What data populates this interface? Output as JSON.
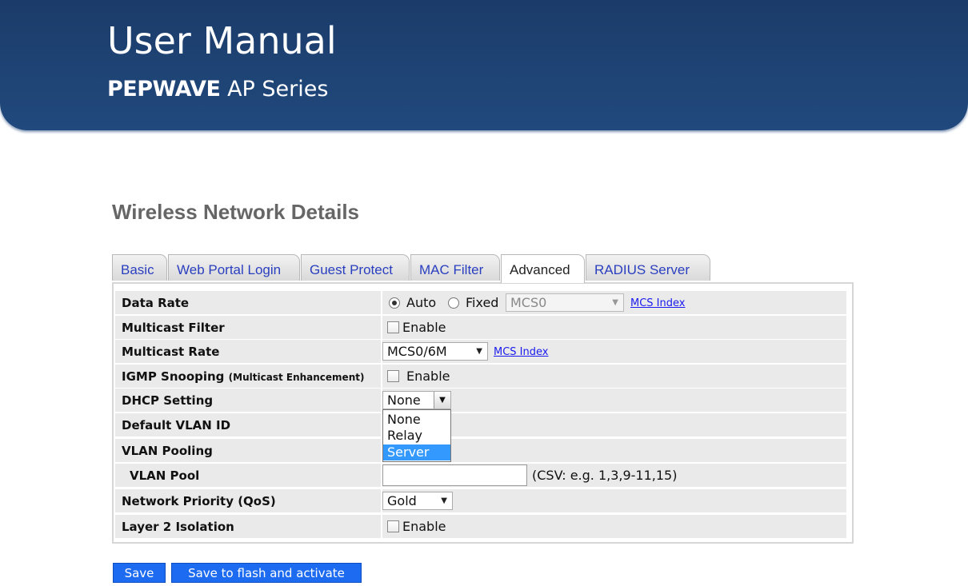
{
  "banner": {
    "title": "User Manual",
    "brand": "PEPWAVE",
    "series": " AP Series"
  },
  "page_title": "Wireless Network Details",
  "tabs": [
    {
      "label": "Basic"
    },
    {
      "label": "Web Portal Login"
    },
    {
      "label": "Guest Protect"
    },
    {
      "label": "MAC Filter"
    },
    {
      "label": "Advanced"
    },
    {
      "label": "RADIUS Server"
    }
  ],
  "active_tab": "Advanced",
  "form": {
    "data_rate": {
      "label": "Data Rate",
      "auto": "Auto",
      "fixed": "Fixed",
      "selected": "auto",
      "fixed_value": "MCS0",
      "link": "MCS Index"
    },
    "multicast_filter": {
      "label": "Multicast Filter",
      "checkbox": "Enable",
      "checked": false
    },
    "multicast_rate": {
      "label": "Multicast Rate",
      "value": "MCS0/6M",
      "link": "MCS Index"
    },
    "igmp_snooping": {
      "label": "IGMP Snooping",
      "note": "(Multicast Enhancement)",
      "checkbox": "Enable",
      "checked": false
    },
    "dhcp_setting": {
      "label": "DHCP Setting",
      "value": "None",
      "options": [
        "None",
        "Relay",
        "Server"
      ],
      "highlighted": "Server"
    },
    "default_vlan": {
      "label": "Default VLAN ID"
    },
    "vlan_pooling": {
      "label": "VLAN Pooling"
    },
    "vlan_pool": {
      "label": "VLAN Pool",
      "value": "",
      "hint": "(CSV: e.g. 1,3,9-11,15)"
    },
    "network_priority": {
      "label": "Network Priority (QoS)",
      "value": "Gold"
    },
    "layer2_isolation": {
      "label": "Layer 2 Isolation",
      "checkbox": "Enable",
      "checked": false
    }
  },
  "buttons": {
    "save": "Save",
    "save_activate": "Save to flash and activate"
  },
  "colors": {
    "banner": "#1f4577",
    "button": "#1c6bf0",
    "tab_link": "#2a3fbf",
    "dropdown_highlight": "#3399ff"
  }
}
